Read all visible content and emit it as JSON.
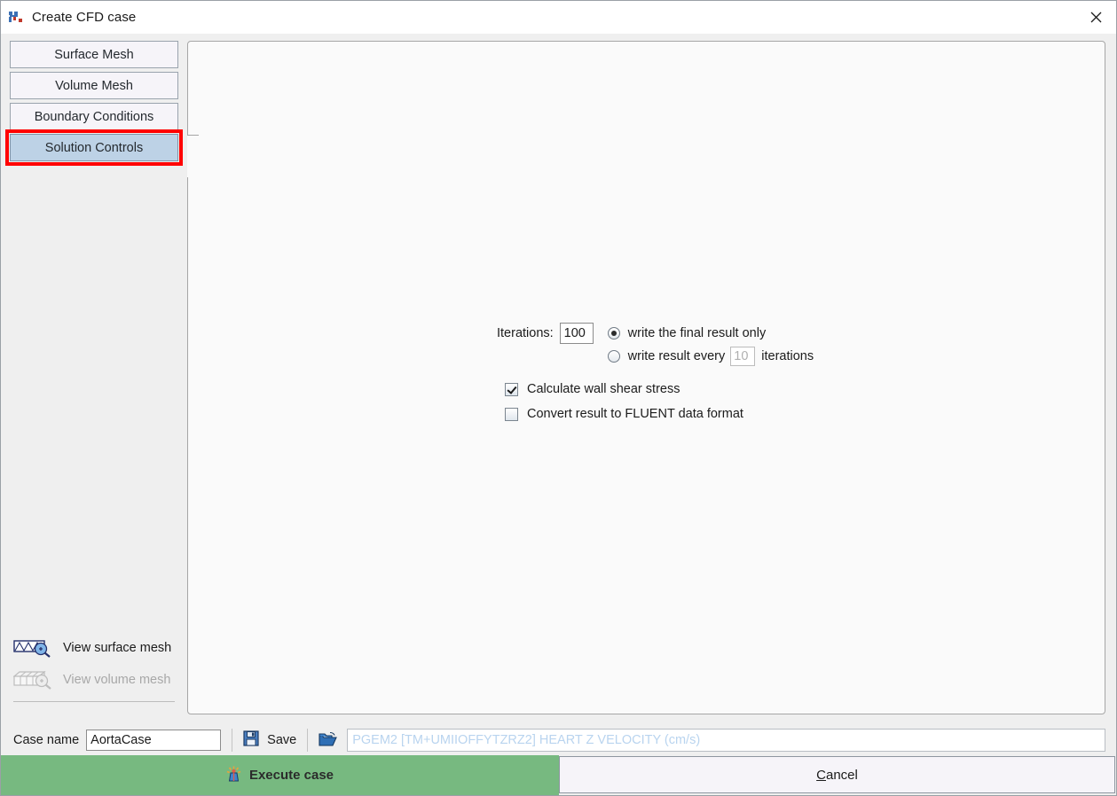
{
  "window": {
    "title": "Create CFD case",
    "title_icon": "cfd-app-icon",
    "close_icon": "close-icon"
  },
  "sidebar": {
    "tabs": [
      {
        "label": "Surface Mesh",
        "selected": false
      },
      {
        "label": "Volume Mesh",
        "selected": false
      },
      {
        "label": "Boundary Conditions",
        "selected": false
      },
      {
        "label": "Solution Controls",
        "selected": true
      }
    ],
    "highlight_color": "#ff0000",
    "selected_color": "#bdd2e6",
    "mesh_links": [
      {
        "label": "View surface mesh",
        "icon": "surface-mesh-magnifier-icon",
        "enabled": true
      },
      {
        "label": "View volume mesh",
        "icon": "volume-mesh-magnifier-icon",
        "enabled": false
      }
    ]
  },
  "solution_controls": {
    "iterations_label": "Iterations:",
    "iterations_value": "100",
    "write_mode": {
      "final_only_label": "write the final result only",
      "final_only_selected": true,
      "every_prefix_label": "write result every",
      "every_value": "10",
      "every_suffix_label": "iterations",
      "every_selected": false
    },
    "checkboxes": [
      {
        "label": "Calculate wall shear stress",
        "checked": true
      },
      {
        "label": "Convert result to FLUENT data format",
        "checked": false
      }
    ]
  },
  "bottom_bar": {
    "case_name_label": "Case name",
    "case_name_value": "AortaCase",
    "save_label": "Save",
    "save_icon": "floppy-disk-icon",
    "open_icon": "open-folder-icon",
    "path_placeholder": "PGEM2 [TM+UMIIOFFYTZRZ2] HEART Z VELOCITY (cm/s)",
    "path_value": ""
  },
  "actions": {
    "execute_label": "Execute case",
    "execute_icon": "firework-icon",
    "execute_color": "#77b980",
    "cancel_accel": "C",
    "cancel_rest": "ancel"
  }
}
